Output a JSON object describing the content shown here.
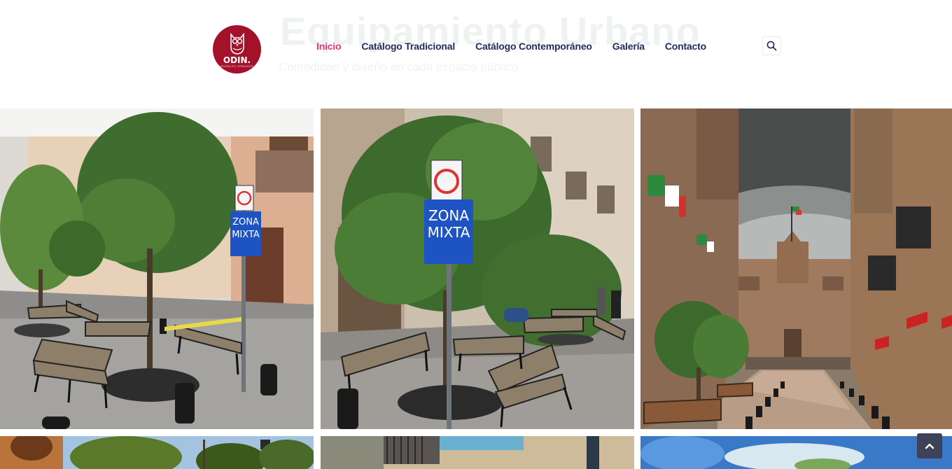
{
  "hero": {
    "title": "Equipamiento Urbano",
    "subtitle": "Comodidad y diseño en cada espacio público"
  },
  "logo": {
    "brand": "ODIN.",
    "tagline": "MUEBLES URBANOS"
  },
  "nav": {
    "items": [
      {
        "label": "Inicio",
        "active": true
      },
      {
        "label": "Catálogo Tradicional",
        "active": false
      },
      {
        "label": "Catálogo Contemporáneo",
        "active": false
      },
      {
        "label": "Galería",
        "active": false
      },
      {
        "label": "Contacto",
        "active": false
      }
    ]
  },
  "search": {
    "icon": "search-icon"
  },
  "gallery": {
    "photo1": {
      "sign_line1": "ZONA",
      "sign_line2": "MIXTA"
    },
    "photo2": {
      "sign_line1": "ZONA",
      "sign_line2": "MIXTA"
    }
  },
  "scroll_top": {
    "icon": "chevron-up-icon"
  },
  "colors": {
    "brand_red": "#a3122a",
    "nav_text": "#232d5c",
    "nav_active": "#e8357a",
    "scroll_button": "#3d4256"
  }
}
